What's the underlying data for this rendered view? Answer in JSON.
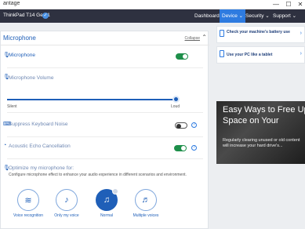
{
  "window": {
    "title": "antage"
  },
  "nav": {
    "device_name": "ThinkPad T14 Gen 1",
    "badge": "✓",
    "items": [
      {
        "label": "Dashboard",
        "active": false
      },
      {
        "label": "Device ⌄",
        "active": true
      },
      {
        "label": "Security ⌄",
        "active": false
      },
      {
        "label": "Support ⌄",
        "active": false
      }
    ]
  },
  "panel": {
    "title": "Microphone",
    "collapse_label": "Collapse",
    "rows": {
      "microphone": {
        "label": "Microphone",
        "enabled": true
      },
      "volume": {
        "label": "Microphone Volume",
        "min_label": "Silent",
        "max_label": "Loud",
        "value_percent": 100
      },
      "suppress": {
        "label": "Suppress Keyboard Noise",
        "enabled": false
      },
      "echo": {
        "label": "Acoustic Echo Cancellation",
        "enabled": true
      }
    },
    "optimize": {
      "label": "Optimize my microphone for:",
      "description": "Configure microphone effect to enhance your audio experience in different scenarios and environment.",
      "options": [
        {
          "label": "Voice recognition",
          "icon": "waveform-icon",
          "selected": false
        },
        {
          "label": "Only my voice",
          "icon": "person-voice-icon",
          "selected": false
        },
        {
          "label": "Normal",
          "icon": "person-sound-icon",
          "selected": true
        },
        {
          "label": "Multiple voices",
          "icon": "multiple-voices-icon",
          "selected": false
        }
      ]
    }
  },
  "side": {
    "cards": [
      {
        "label": "Check your machine's battery use"
      },
      {
        "label": "Use your PC like a tablet"
      }
    ],
    "promo": {
      "title": "Easy Ways to Free Up Space on Your",
      "body": "Regularly clearing unused or old content will increase your hard drive's..."
    }
  },
  "colors": {
    "accent": "#1f5fb8",
    "toggle_on": "#1e8f4a",
    "navbar": "#2e3140"
  }
}
